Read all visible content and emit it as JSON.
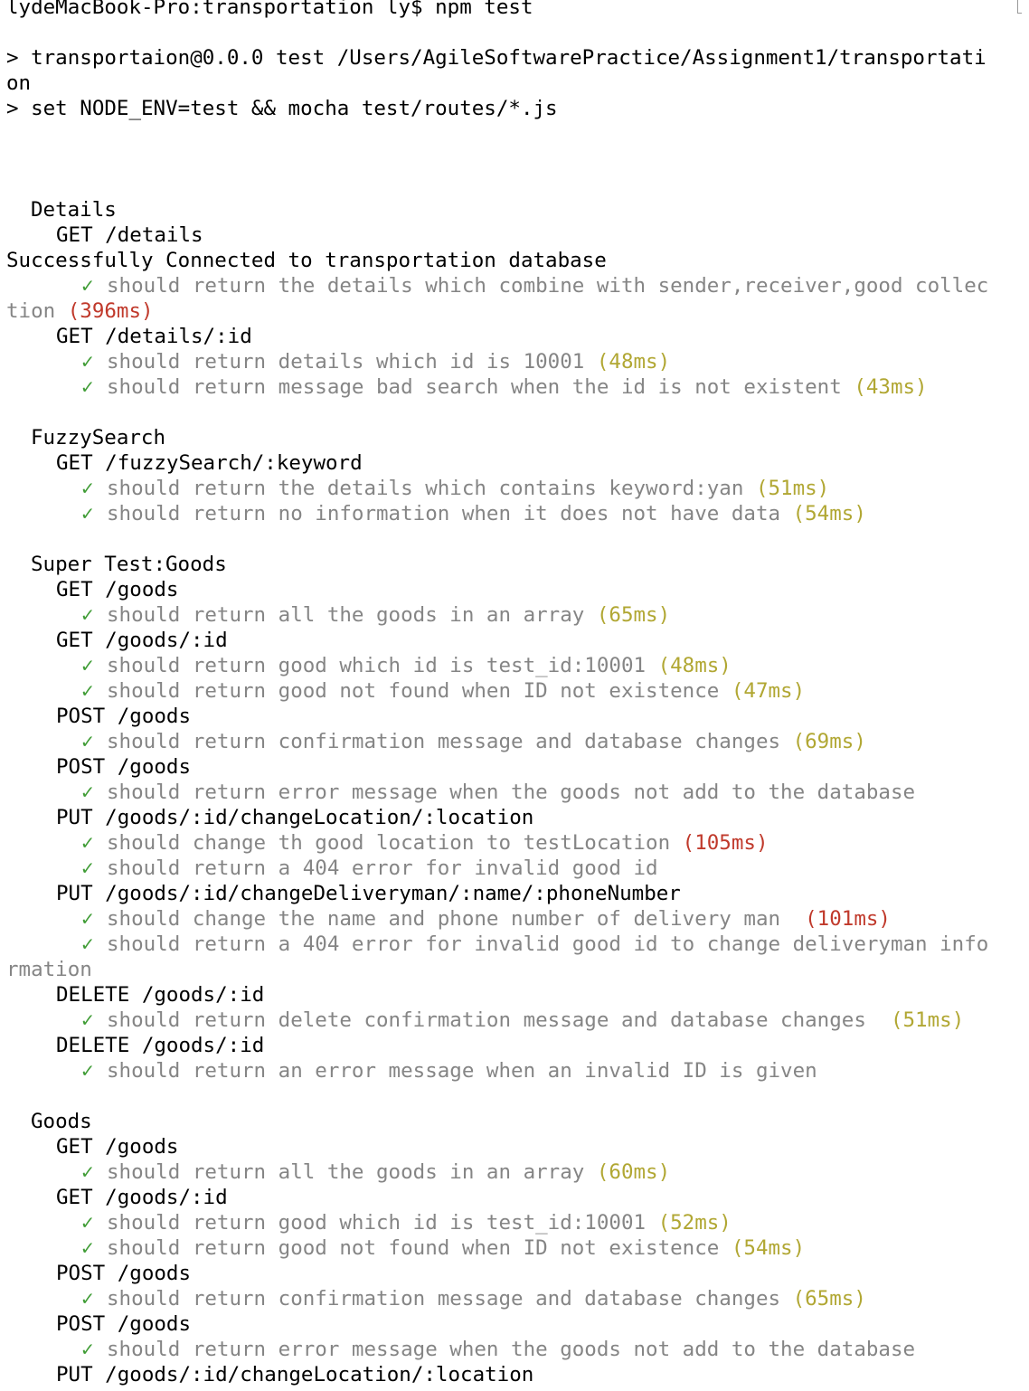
{
  "terminal": {
    "lines": [
      {
        "kind": "plain",
        "text": "lydeMacBook-Pro:transportation ly$ npm test"
      },
      {
        "kind": "blank"
      },
      {
        "kind": "plain",
        "text": "> transportaion@0.0.0 test /Users/AgileSoftwarePractice/Assignment1/transportati"
      },
      {
        "kind": "plain",
        "text": "on"
      },
      {
        "kind": "plain",
        "text": "> set NODE_ENV=test && mocha test/routes/*.js"
      },
      {
        "kind": "blank"
      },
      {
        "kind": "blank"
      },
      {
        "kind": "blank"
      },
      {
        "kind": "suite",
        "indent": 1,
        "text": "Details"
      },
      {
        "kind": "suite",
        "indent": 2,
        "text": "GET /details"
      },
      {
        "kind": "plain",
        "text": "Successfully Connected to transportation database"
      },
      {
        "kind": "pass",
        "text": "should return the details which combine with sender,receiver,good collec",
        "duration": ""
      },
      {
        "kind": "wrap",
        "text": "tion",
        "duration": "(396ms)",
        "speed": "slow"
      },
      {
        "kind": "suite",
        "indent": 2,
        "text": "GET /details/:id"
      },
      {
        "kind": "pass",
        "text": "should return details which id is 10001",
        "duration": "(48ms)",
        "speed": "medium"
      },
      {
        "kind": "pass",
        "text": "should return message bad search when the id is not existent",
        "duration": "(43ms)",
        "speed": "medium"
      },
      {
        "kind": "blank"
      },
      {
        "kind": "suite",
        "indent": 1,
        "text": "FuzzySearch"
      },
      {
        "kind": "suite",
        "indent": 2,
        "text": "GET /fuzzySearch/:keyword"
      },
      {
        "kind": "pass",
        "text": "should return the details which contains keyword:yan",
        "duration": "(51ms)",
        "speed": "medium"
      },
      {
        "kind": "pass",
        "text": "should return no information when it does not have data",
        "duration": "(54ms)",
        "speed": "medium"
      },
      {
        "kind": "blank"
      },
      {
        "kind": "suite",
        "indent": 1,
        "text": "Super Test:Goods"
      },
      {
        "kind": "suite",
        "indent": 2,
        "text": "GET /goods"
      },
      {
        "kind": "pass",
        "text": "should return all the goods in an array",
        "duration": "(65ms)",
        "speed": "medium"
      },
      {
        "kind": "suite",
        "indent": 2,
        "text": "GET /goods/:id"
      },
      {
        "kind": "pass",
        "text": "should return good which id is test_id:10001",
        "duration": "(48ms)",
        "speed": "medium"
      },
      {
        "kind": "pass",
        "text": "should return good not found when ID not existence",
        "duration": "(47ms)",
        "speed": "medium"
      },
      {
        "kind": "suite",
        "indent": 2,
        "text": "POST /goods"
      },
      {
        "kind": "pass",
        "text": "should return confirmation message and database changes",
        "duration": "(69ms)",
        "speed": "medium"
      },
      {
        "kind": "suite",
        "indent": 2,
        "text": "POST /goods"
      },
      {
        "kind": "pass",
        "text": "should return error message when the goods not add to the database",
        "duration": ""
      },
      {
        "kind": "suite",
        "indent": 2,
        "text": "PUT /goods/:id/changeLocation/:location"
      },
      {
        "kind": "pass",
        "text": "should change th good location to testLocation",
        "duration": "(105ms)",
        "speed": "slow"
      },
      {
        "kind": "pass",
        "text": "should return a 404 error for invalid good id",
        "duration": ""
      },
      {
        "kind": "suite",
        "indent": 2,
        "text": "PUT /goods/:id/changeDeliveryman/:name/:phoneNumber"
      },
      {
        "kind": "pass",
        "text": "should change the name and phone number of delivery man ",
        "duration": "(101ms)",
        "speed": "slow"
      },
      {
        "kind": "pass",
        "text": "should return a 404 error for invalid good id to change deliveryman info",
        "duration": ""
      },
      {
        "kind": "wrap",
        "text": "rmation",
        "duration": ""
      },
      {
        "kind": "suite",
        "indent": 2,
        "text": "DELETE /goods/:id"
      },
      {
        "kind": "pass",
        "text": "should return delete confirmation message and database changes ",
        "duration": "(51ms)",
        "speed": "medium"
      },
      {
        "kind": "suite",
        "indent": 2,
        "text": "DELETE /goods/:id"
      },
      {
        "kind": "pass",
        "text": "should return an error message when an invalid ID is given",
        "duration": ""
      },
      {
        "kind": "blank"
      },
      {
        "kind": "suite",
        "indent": 1,
        "text": "Goods"
      },
      {
        "kind": "suite",
        "indent": 2,
        "text": "GET /goods"
      },
      {
        "kind": "pass",
        "text": "should return all the goods in an array",
        "duration": "(60ms)",
        "speed": "medium"
      },
      {
        "kind": "suite",
        "indent": 2,
        "text": "GET /goods/:id"
      },
      {
        "kind": "pass",
        "text": "should return good which id is test_id:10001",
        "duration": "(52ms)",
        "speed": "medium"
      },
      {
        "kind": "pass",
        "text": "should return good not found when ID not existence",
        "duration": "(54ms)",
        "speed": "medium"
      },
      {
        "kind": "suite",
        "indent": 2,
        "text": "POST /goods"
      },
      {
        "kind": "pass",
        "text": "should return confirmation message and database changes",
        "duration": "(65ms)",
        "speed": "medium"
      },
      {
        "kind": "suite",
        "indent": 2,
        "text": "POST /goods"
      },
      {
        "kind": "pass",
        "text": "should return error message when the goods not add to the database",
        "duration": ""
      },
      {
        "kind": "suite",
        "indent": 2,
        "text": "PUT /goods/:id/changeLocation/:location"
      }
    ],
    "check_glyph": "✓",
    "colors": {
      "background": "#ffffff",
      "text": "#000000",
      "pass_text": "#858585",
      "check": "#3f9c35",
      "duration_medium": "#b1a733",
      "duration_slow": "#c0392b"
    }
  }
}
